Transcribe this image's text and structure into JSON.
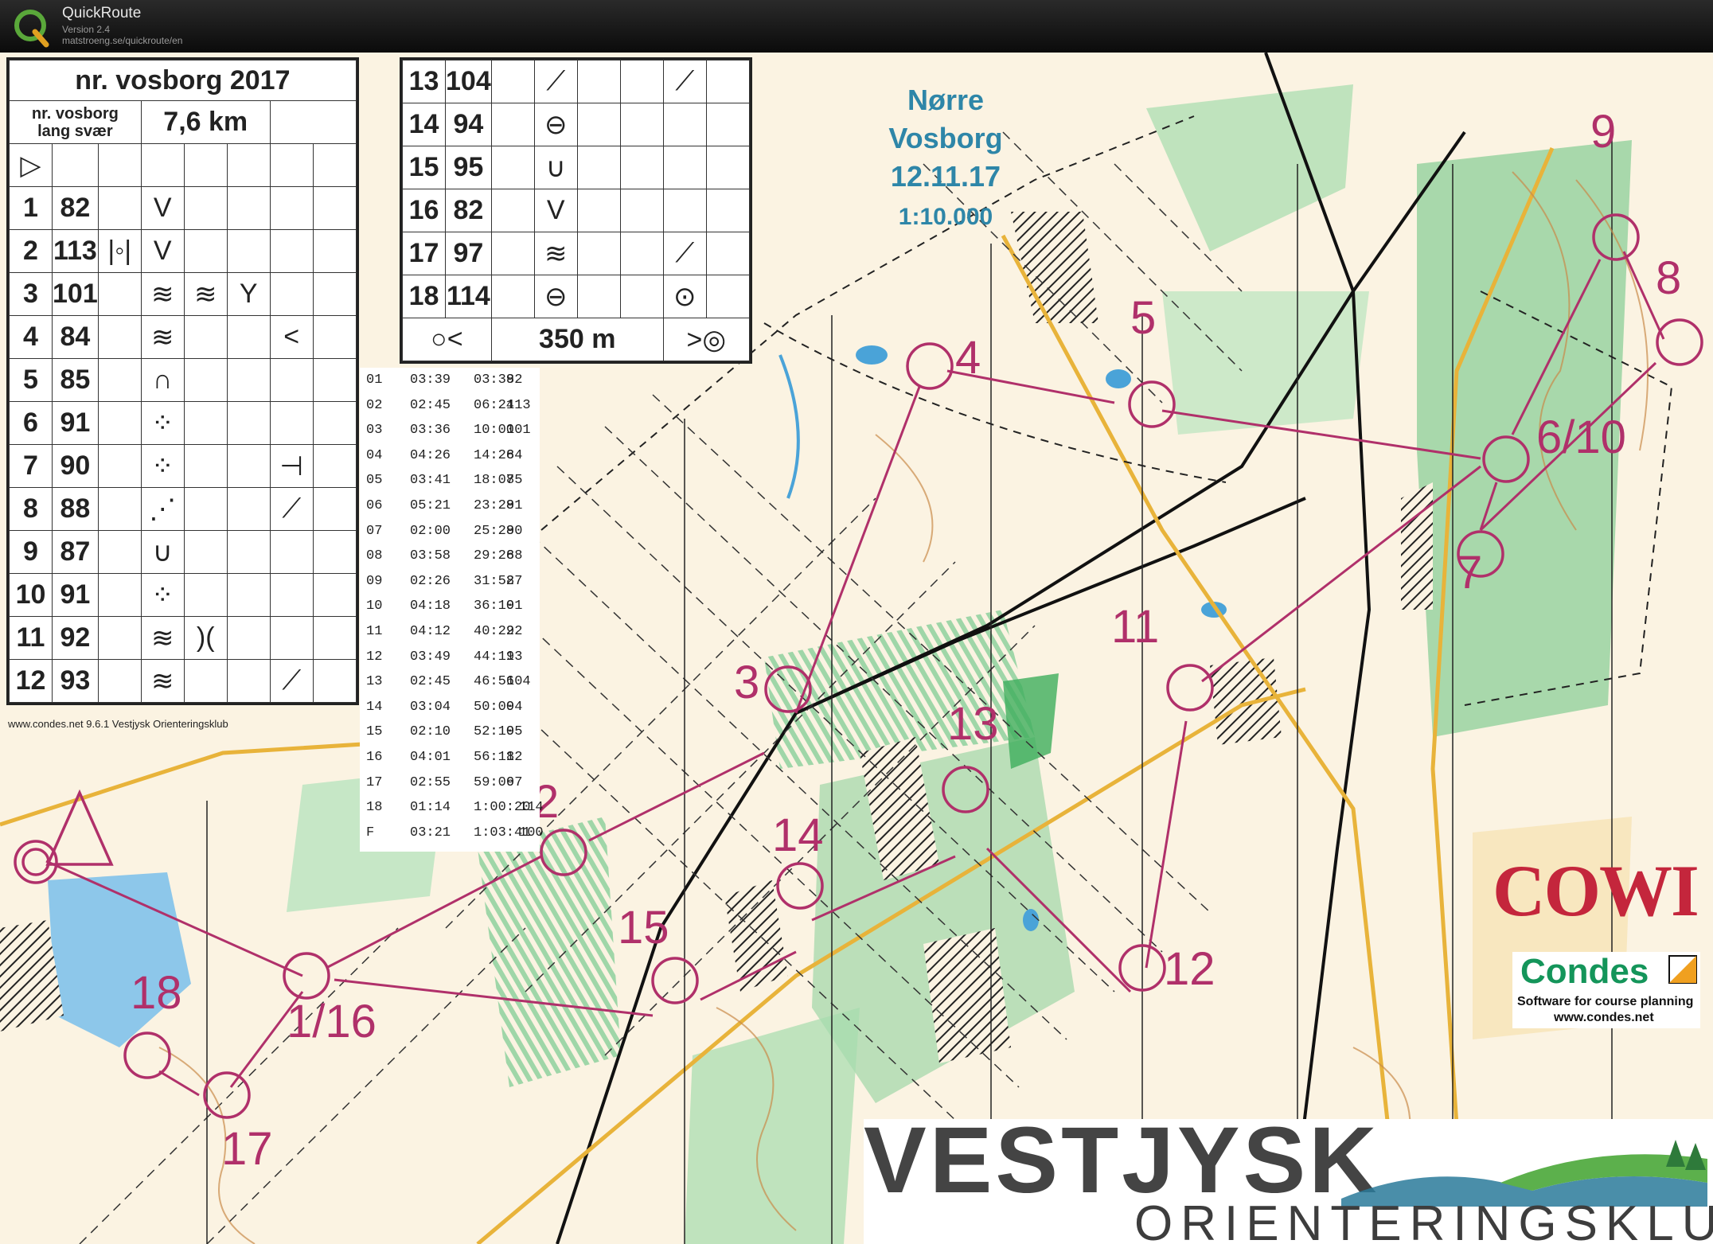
{
  "window": {
    "app_name": "QuickRoute",
    "version": "Version 2.4",
    "url": "matstroeng.se/quickroute/en",
    "logo_letter": "Q"
  },
  "map": {
    "title_lines": [
      "Nørre",
      "Vosborg",
      "12.11.17"
    ],
    "scale": "1:10.000",
    "footer_credit": "www.condes.net 9.6.1 Vestjysk Orienteringsklub",
    "sponsor": "COWI",
    "condes": {
      "name": "Condes",
      "tagline": "Software for course planning",
      "url": "www.condes.net"
    },
    "club": {
      "line1": "VESTJYSK",
      "line2": "ORIENTERINGSKLUB"
    },
    "colors": {
      "course": "#b0306a",
      "paper": "#fbf3e2",
      "vegetation": "#7cc58c",
      "water": "#4aa3d8"
    }
  },
  "description_card": {
    "event": "nr. vosborg 2017",
    "course": [
      "nr. vosborg",
      "lang svær"
    ],
    "length": "7,6 km",
    "start_symbol": "▷",
    "controls": [
      {
        "n": "1",
        "code": "82",
        "c": "",
        "d": "V",
        "e": "",
        "g": ""
      },
      {
        "n": "2",
        "code": "113",
        "c": "|◦|",
        "d": "V",
        "e": "",
        "g": ""
      },
      {
        "n": "3",
        "code": "101",
        "c": "",
        "d": "≋",
        "e": "≋",
        "f": "Y",
        "g": ""
      },
      {
        "n": "4",
        "code": "84",
        "c": "",
        "d": "≋",
        "e": "",
        "g": "<"
      },
      {
        "n": "5",
        "code": "85",
        "c": "",
        "d": "∩",
        "e": "",
        "g": ""
      },
      {
        "n": "6",
        "code": "91",
        "c": "",
        "d": "⁘",
        "e": "",
        "g": ""
      },
      {
        "n": "7",
        "code": "90",
        "c": "",
        "d": "⁘",
        "e": "",
        "g": "⊣"
      },
      {
        "n": "8",
        "code": "88",
        "c": "",
        "d": "⋰",
        "e": "",
        "g": "⟋"
      },
      {
        "n": "9",
        "code": "87",
        "c": "",
        "d": "∪",
        "e": "",
        "g": ""
      },
      {
        "n": "10",
        "code": "91",
        "c": "",
        "d": "⁘",
        "e": "",
        "g": ""
      },
      {
        "n": "11",
        "code": "92",
        "c": "",
        "d": "≋",
        "e": ")(",
        "g": ""
      },
      {
        "n": "12",
        "code": "93",
        "c": "",
        "d": "≋",
        "e": "",
        "g": "⟋"
      },
      {
        "n": "13",
        "code": "104",
        "c": "",
        "d": "⟋",
        "e": "",
        "g": "⟋"
      },
      {
        "n": "14",
        "code": "94",
        "c": "",
        "d": "⊖",
        "e": "",
        "g": ""
      },
      {
        "n": "15",
        "code": "95",
        "c": "",
        "d": "∪",
        "e": "",
        "g": ""
      },
      {
        "n": "16",
        "code": "82",
        "c": "",
        "d": "V",
        "e": "",
        "g": ""
      },
      {
        "n": "17",
        "code": "97",
        "c": "",
        "d": "≋",
        "e": "",
        "g": "⟋"
      },
      {
        "n": "18",
        "code": "114",
        "c": "",
        "d": "⊖",
        "e": "",
        "g": "⊙"
      }
    ],
    "finish": {
      "left": "○<",
      "distance": "350 m",
      "right": ">◎"
    }
  },
  "splits": [
    {
      "leg": "01",
      "time": "03:39",
      "total": "03:39",
      "code": "82"
    },
    {
      "leg": "02",
      "time": "02:45",
      "total": "06:24",
      "code": "113"
    },
    {
      "leg": "03",
      "time": "03:36",
      "total": "10:00",
      "code": "101"
    },
    {
      "leg": "04",
      "time": "04:26",
      "total": "14:26",
      "code": "84"
    },
    {
      "leg": "05",
      "time": "03:41",
      "total": "18:07",
      "code": "85"
    },
    {
      "leg": "06",
      "time": "05:21",
      "total": "23:28",
      "code": "91"
    },
    {
      "leg": "07",
      "time": "02:00",
      "total": "25:28",
      "code": "90"
    },
    {
      "leg": "08",
      "time": "03:58",
      "total": "29:26",
      "code": "88"
    },
    {
      "leg": "09",
      "time": "02:26",
      "total": "31:52",
      "code": "87"
    },
    {
      "leg": "10",
      "time": "04:18",
      "total": "36:10",
      "code": "91"
    },
    {
      "leg": "11",
      "time": "04:12",
      "total": "40:22",
      "code": "92"
    },
    {
      "leg": "12",
      "time": "03:49",
      "total": "44:11",
      "code": "93"
    },
    {
      "leg": "13",
      "time": "02:45",
      "total": "46:56",
      "code": "104"
    },
    {
      "leg": "14",
      "time": "03:04",
      "total": "50:00",
      "code": "94"
    },
    {
      "leg": "15",
      "time": "02:10",
      "total": "52:10",
      "code": "95"
    },
    {
      "leg": "16",
      "time": "04:01",
      "total": "56:11",
      "code": "82"
    },
    {
      "leg": "17",
      "time": "02:55",
      "total": "59:06",
      "code": "97"
    },
    {
      "leg": "18",
      "time": "01:14",
      "total": "1:00:20",
      "code": "114"
    },
    {
      "leg": "F",
      "time": "03:21",
      "total": "1:03:41",
      "code": "100"
    }
  ],
  "course_labels": [
    {
      "label": "1/16"
    },
    {
      "label": "2"
    },
    {
      "label": "3"
    },
    {
      "label": "4"
    },
    {
      "label": "5"
    },
    {
      "label": "6/10"
    },
    {
      "label": "7"
    },
    {
      "label": "8"
    },
    {
      "label": "9"
    },
    {
      "label": "11"
    },
    {
      "label": "12"
    },
    {
      "label": "13"
    },
    {
      "label": "14"
    },
    {
      "label": "15"
    },
    {
      "label": "17"
    },
    {
      "label": "18"
    }
  ]
}
